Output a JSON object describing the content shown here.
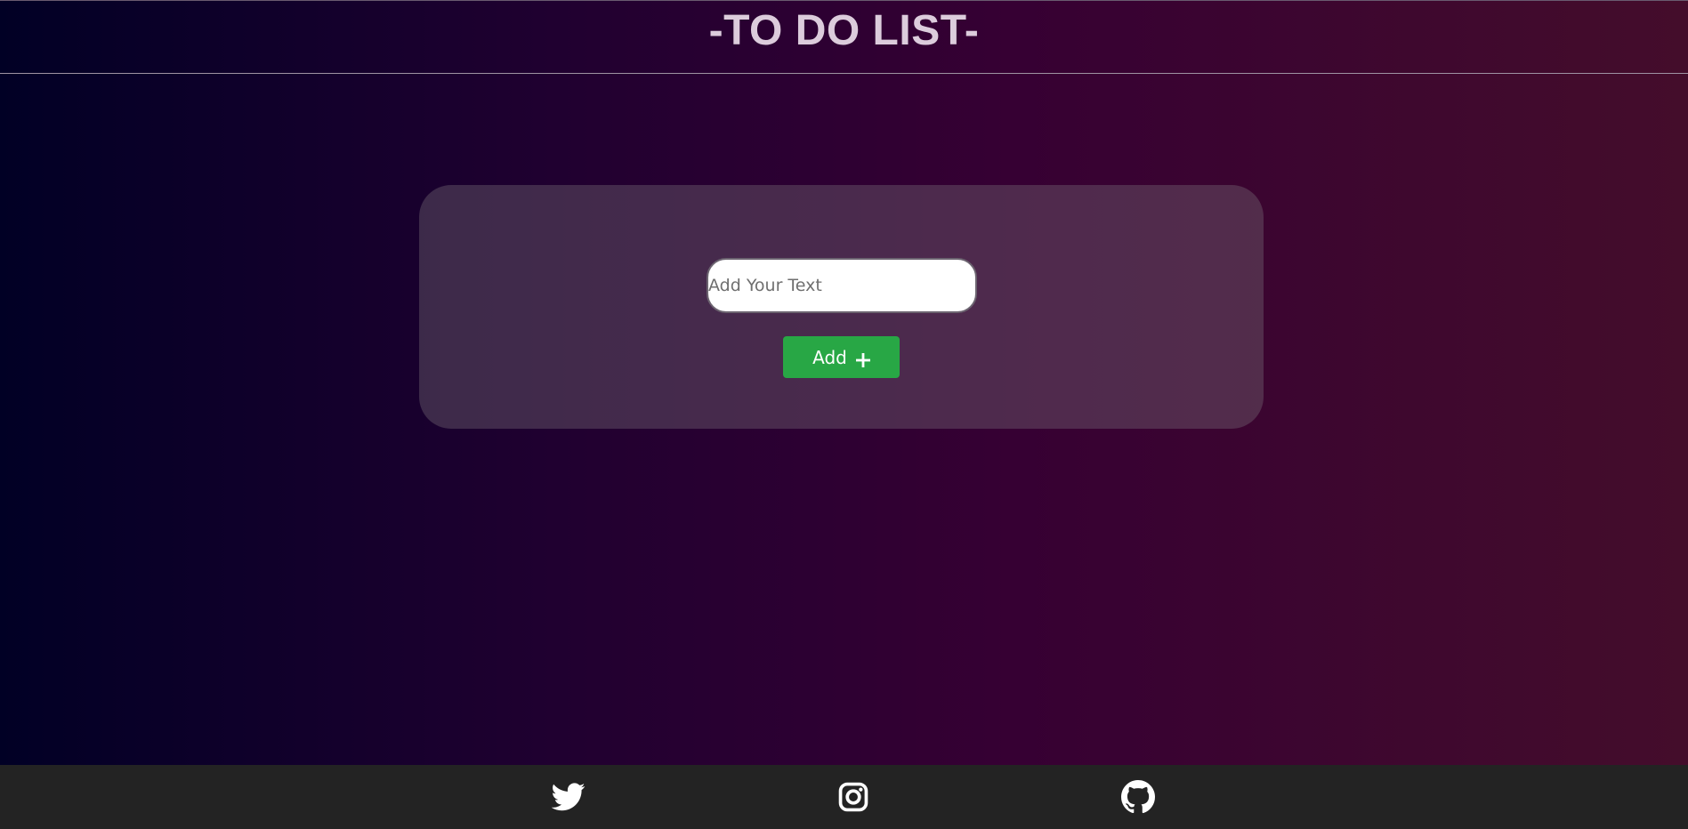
{
  "header": {
    "title": "-TO DO LIST-"
  },
  "form": {
    "input_placeholder": "Add Your Text",
    "input_value": "",
    "add_label": "Add"
  },
  "footer": {
    "icons": [
      "twitter-icon",
      "instagram-icon",
      "github-icon"
    ]
  },
  "colors": {
    "accent": "#28a745",
    "title": "#dcccdc",
    "footer_bg": "#232323",
    "gradient_start": "#010025",
    "gradient_end": "#440d2b"
  }
}
